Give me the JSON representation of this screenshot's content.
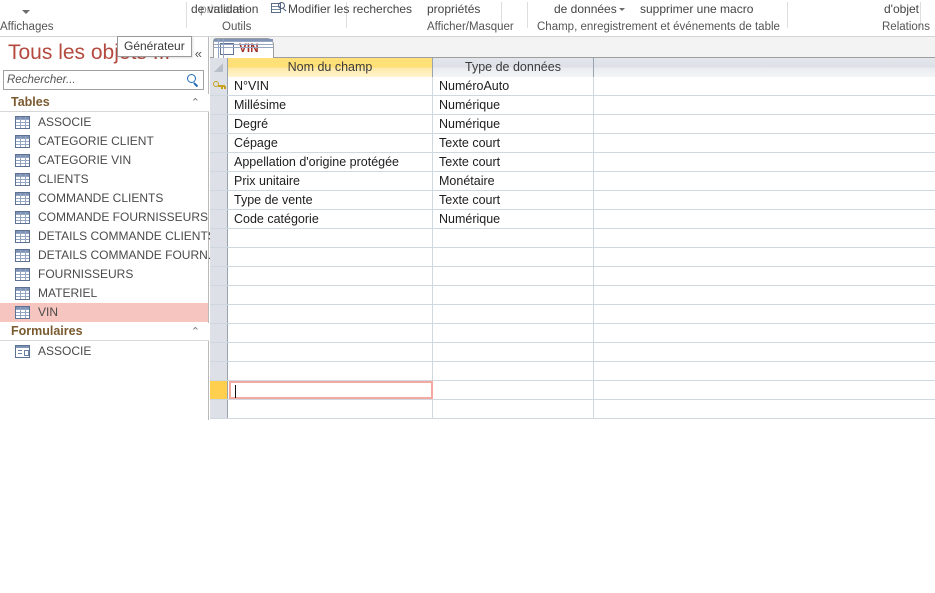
{
  "ribbon": {
    "groups": [
      {
        "id": "affichages",
        "top_label": "",
        "caption": "Affichages",
        "has_caret": true
      },
      {
        "id": "outils_primaire",
        "top_label": "primaire",
        "caption": "",
        "dim": true
      },
      {
        "id": "outils_validation",
        "top_label": "de validation",
        "caption": "Outils"
      },
      {
        "id": "outils_recherches",
        "top_label": "Modifier les recherches",
        "caption": "",
        "icon": "lookup-icon"
      },
      {
        "id": "afficher_masquer",
        "top_label": "propriétés",
        "caption": "Afficher/Masquer"
      },
      {
        "id": "champ_evenements",
        "top_label": "de données",
        "caption": "Champ, enregistrement et événements de table",
        "has_mini_caret": true
      },
      {
        "id": "supprimer_macro",
        "top_label": "supprimer une macro",
        "caption": ""
      },
      {
        "id": "relations",
        "top_label": "d'objet",
        "caption": "Relations"
      }
    ]
  },
  "navpane": {
    "title": "Tous les objets ...",
    "collapse_glyph": "«",
    "search": {
      "placeholder": "Rechercher...",
      "value": ""
    },
    "tooltip": "Générateur",
    "groups": [
      {
        "label": "Tables",
        "chevron": "⌃",
        "items": [
          {
            "label": "ASSOCIE",
            "icon": "table-icon",
            "selected": false
          },
          {
            "label": "CATEGORIE CLIENT",
            "icon": "table-icon",
            "selected": false
          },
          {
            "label": "CATEGORIE VIN",
            "icon": "table-icon",
            "selected": false
          },
          {
            "label": "CLIENTS",
            "icon": "table-icon",
            "selected": false
          },
          {
            "label": "COMMANDE CLIENTS",
            "icon": "table-icon",
            "selected": false
          },
          {
            "label": "COMMANDE FOURNISSEURS",
            "icon": "table-icon",
            "selected": false
          },
          {
            "label": "DETAILS COMMANDE CLIENTS",
            "icon": "table-icon",
            "selected": false
          },
          {
            "label": "DETAILS COMMANDE FOURN...",
            "icon": "table-icon",
            "selected": false
          },
          {
            "label": "FOURNISSEURS",
            "icon": "table-icon",
            "selected": false
          },
          {
            "label": "MATERIEL",
            "icon": "table-icon",
            "selected": false
          },
          {
            "label": "VIN",
            "icon": "table-icon",
            "selected": true
          }
        ]
      },
      {
        "label": "Formulaires",
        "chevron": "⌃",
        "items": [
          {
            "label": "ASSOCIE",
            "icon": "form-icon",
            "selected": false
          }
        ]
      }
    ]
  },
  "document": {
    "tab": {
      "label": "VIN",
      "icon": "table-icon"
    },
    "grid": {
      "headers": {
        "field_name": "Nom du champ",
        "data_type": "Type de données",
        "description": ""
      },
      "rows": [
        {
          "name": "N°VIN",
          "type": "NuméroAuto",
          "description": "",
          "primary_key": true
        },
        {
          "name": "Millésime",
          "type": "Numérique",
          "description": "",
          "primary_key": false
        },
        {
          "name": "Degré",
          "type": "Numérique",
          "description": "",
          "primary_key": false
        },
        {
          "name": "Cépage",
          "type": "Texte court",
          "description": "",
          "primary_key": false
        },
        {
          "name": "Appellation d'origine protégée",
          "type": "Texte court",
          "description": "",
          "primary_key": false
        },
        {
          "name": "Prix unitaire",
          "type": "Monétaire",
          "description": "",
          "primary_key": false
        },
        {
          "name": "Type de vente",
          "type": "Texte court",
          "description": "",
          "primary_key": false
        },
        {
          "name": "Code catégorie",
          "type": "Numérique",
          "description": "",
          "primary_key": false
        },
        {
          "name": "",
          "type": "",
          "description": "",
          "primary_key": false
        },
        {
          "name": "",
          "type": "",
          "description": "",
          "primary_key": false
        },
        {
          "name": "",
          "type": "",
          "description": "",
          "primary_key": false
        },
        {
          "name": "",
          "type": "",
          "description": "",
          "primary_key": false
        },
        {
          "name": "",
          "type": "",
          "description": "",
          "primary_key": false
        },
        {
          "name": "",
          "type": "",
          "description": "",
          "primary_key": false
        },
        {
          "name": "",
          "type": "",
          "description": "",
          "primary_key": false
        },
        {
          "name": "",
          "type": "",
          "description": "",
          "primary_key": false
        },
        {
          "name": "",
          "type": "",
          "description": "",
          "primary_key": false,
          "active": true
        },
        {
          "name": "",
          "type": "",
          "description": "",
          "primary_key": false
        }
      ]
    }
  },
  "colors": {
    "header_field_name": "#ffdf73",
    "header_data_type": "#dde1e7",
    "selected_nav_item": "#f7c5bf",
    "active_row_selector": "#ffcf4d",
    "active_cell_border": "#f4a9a0",
    "navpane_title": "#b44a3f",
    "tab_label": "#a03027",
    "group_label": "#7a5a2f"
  }
}
